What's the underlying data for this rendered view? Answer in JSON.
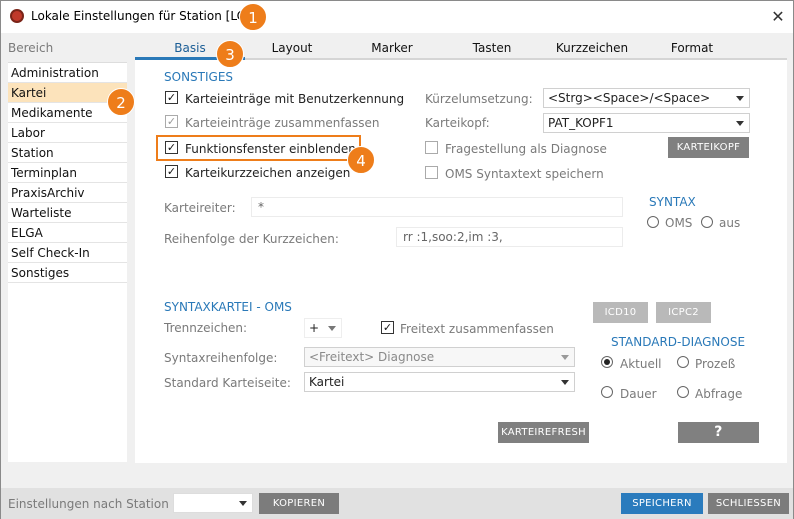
{
  "window": {
    "title": "Lokale Einstellungen für Station [LOC]",
    "close": "✕"
  },
  "badges": [
    "1",
    "2",
    "3",
    "4"
  ],
  "sidebar": {
    "header": "Bereich",
    "items": [
      {
        "label": "Administration"
      },
      {
        "label": "Kartei"
      },
      {
        "label": "Medikamente"
      },
      {
        "label": "Labor"
      },
      {
        "label": "Station"
      },
      {
        "label": "Terminplan"
      },
      {
        "label": "PraxisArchiv"
      },
      {
        "label": "Warteliste"
      },
      {
        "label": "ELGA"
      },
      {
        "label": "Self Check-In"
      },
      {
        "label": "Sonstiges"
      }
    ],
    "active_index": 1
  },
  "tabs": [
    "Basis",
    "Layout",
    "Marker",
    "Tasten",
    "Kurzzeichen",
    "Format"
  ],
  "sonstiges": {
    "header": "SONSTIGES",
    "checks": [
      {
        "label": "Karteieinträge mit Benutzerkennung",
        "checked": true
      },
      {
        "label": "Karteieinträge zusammenfassen",
        "checked": true
      },
      {
        "label": "Funktionsfenster einblenden",
        "checked": true
      },
      {
        "label": "Karteikurzzeichen anzeigen",
        "checked": true
      }
    ],
    "kuerzel_label": "Kürzelumsetzung:",
    "kuerzel_value": "<Strg><Space>/<Space>",
    "karteikopf_label": "Karteikopf:",
    "karteikopf_value": "PAT_KOPF1",
    "frage_label": "Fragestellung als Diagnose",
    "oms_label": "OMS Syntaxtext speichern",
    "karteikopf_button": "KARTEIKOPF"
  },
  "karteireiter": {
    "label": "Karteireiter:",
    "value": "*"
  },
  "reihenfolge": {
    "label": "Reihenfolge der Kurzzeichen:",
    "value": "rr :1,soo:2,im :3,"
  },
  "syntax": {
    "header": "SYNTAX",
    "opt1": "OMS",
    "opt2": "aus"
  },
  "syntaxkartei": {
    "header": "SYNTAXKARTEI - OMS",
    "trenn_label": "Trennzeichen:",
    "trenn_value": "+",
    "freitext_label": "Freitext zusammenfassen",
    "folge_label": "Syntaxreihenfolge:",
    "folge_value": "<Freitext> Diagnose",
    "seite_label": "Standard Karteiseite:",
    "seite_value": "Kartei"
  },
  "codes": {
    "icd": "ICD10",
    "icpc": "ICPC2"
  },
  "standard_diagnose": {
    "header": "STANDARD-DIAGNOSE",
    "opts": [
      "Aktuell",
      "Prozeß",
      "Dauer",
      "Abfrage"
    ],
    "selected": "Aktuell"
  },
  "buttons": {
    "refresh": "KARTEIREFRESH",
    "help": "?",
    "kopieren": "KOPIEREN",
    "speichern": "SPEICHERN",
    "schliessen": "SCHLIESSEN"
  },
  "footer": {
    "label": "Einstellungen nach Station"
  }
}
